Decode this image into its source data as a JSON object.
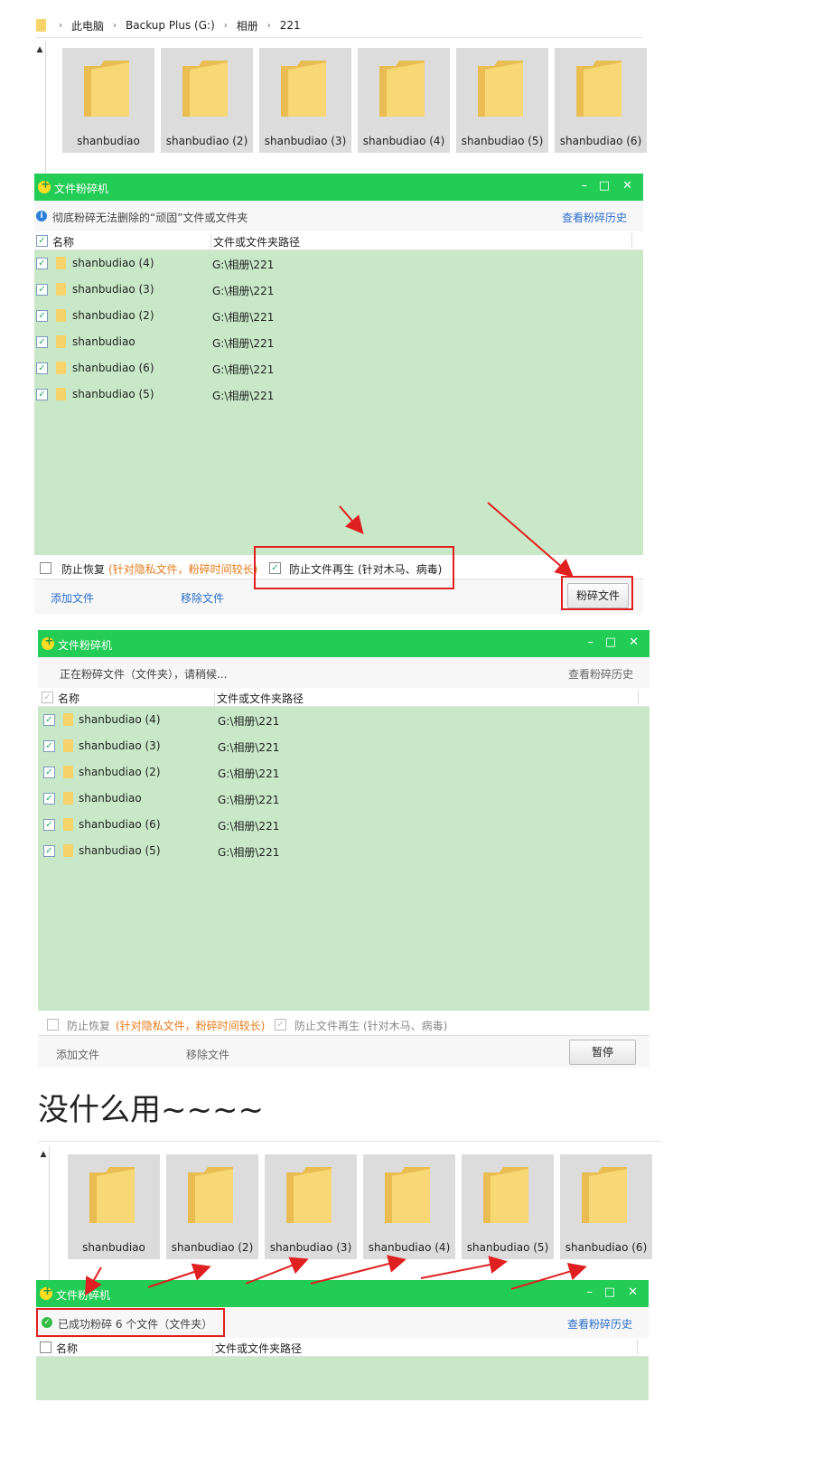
{
  "explorer": {
    "breadcrumb": [
      "此电脑",
      "Backup Plus (G:)",
      "相册",
      "221"
    ],
    "folders_top": [
      "shanbudiao",
      "shanbudiao (2)",
      "shanbudiao (3)",
      "shanbudiao (4)",
      "shanbudiao (5)",
      "shanbudiao (6)"
    ],
    "folders_bottom": [
      "shanbudiao",
      "shanbudiao (2)",
      "shanbudiao (3)",
      "shanbudiao (4)",
      "shanbudiao (5)",
      "shanbudiao (6)"
    ]
  },
  "shredder": {
    "title": "文件粉碎机",
    "controls": {
      "minimize": "–",
      "maximize": "□",
      "close": "✕"
    },
    "history_link": "查看粉碎历史",
    "col_name": "名称",
    "col_path": "文件或文件夹路径",
    "opt_recover_label": "防止恢复",
    "opt_recover_note": "(针对隐私文件，粉碎时间较长)",
    "opt_regen_label": "防止文件再生",
    "opt_regen_note": "(针对木马、病毒)",
    "add_files": "添加文件",
    "remove_files": "移除文件"
  },
  "window1": {
    "info": "彻底粉碎无法删除的“顽固”文件或文件夹",
    "shred_button": "粉碎文件",
    "rows": [
      {
        "name": "shanbudiao (4)",
        "path": "G:\\相册\\221"
      },
      {
        "name": "shanbudiao (3)",
        "path": "G:\\相册\\221"
      },
      {
        "name": "shanbudiao (2)",
        "path": "G:\\相册\\221"
      },
      {
        "name": "shanbudiao",
        "path": "G:\\相册\\221"
      },
      {
        "name": "shanbudiao (6)",
        "path": "G:\\相册\\221"
      },
      {
        "name": "shanbudiao (5)",
        "path": "G:\\相册\\221"
      }
    ]
  },
  "window2": {
    "info": "正在粉碎文件（文件夹），请稍候...",
    "pause_button": "暂停",
    "rows": [
      {
        "name": "shanbudiao (4)",
        "path": "G:\\相册\\221"
      },
      {
        "name": "shanbudiao (3)",
        "path": "G:\\相册\\221"
      },
      {
        "name": "shanbudiao (2)",
        "path": "G:\\相册\\221"
      },
      {
        "name": "shanbudiao",
        "path": "G:\\相册\\221"
      },
      {
        "name": "shanbudiao (6)",
        "path": "G:\\相册\\221"
      },
      {
        "name": "shanbudiao (5)",
        "path": "G:\\相册\\221"
      }
    ]
  },
  "window3": {
    "info": "已成功粉碎 6 个文件（文件夹）"
  },
  "caption": "没什么用~~~~",
  "colors": {
    "titlebar": "#22cc55",
    "list_bg": "#c8e8c8",
    "link": "#2b6fcc",
    "annotation": "#e02020",
    "folder": "#f6d36b"
  }
}
